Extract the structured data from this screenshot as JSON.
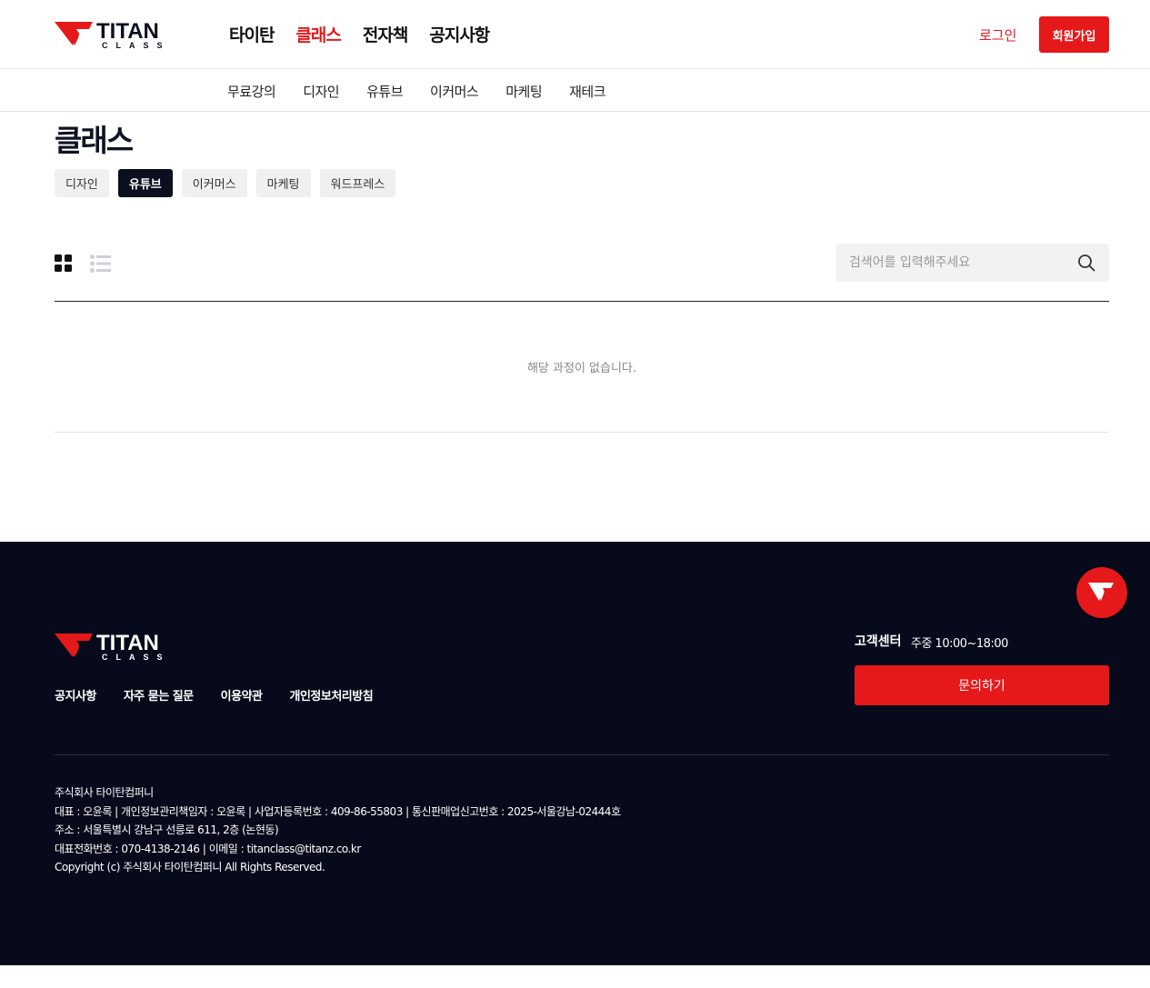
{
  "brand": {
    "logo_text": "TITAN",
    "logo_subtext": "CLASS",
    "accent_color": "#e6191a",
    "dark_color": "#060a1b"
  },
  "header": {
    "nav": [
      "타이탄",
      "클래스",
      "전자책",
      "공지사항"
    ],
    "active_nav": "클래스",
    "login_label": "로그인",
    "signup_label": "회원가입"
  },
  "sub_nav": [
    "무료강의",
    "디자인",
    "유튜브",
    "이커머스",
    "마케팅",
    "재테크"
  ],
  "page": {
    "title": "클래스",
    "chips": [
      "디자인",
      "유튜브",
      "이커머스",
      "마케팅",
      "워드프레스"
    ],
    "active_chip": "유튜브",
    "search_placeholder": "검색어를 입력해주세요",
    "empty_message": "해당 과정이 없습니다.",
    "view_mode": "grid"
  },
  "footer": {
    "links": [
      "공지사항",
      "자주 묻는 질문",
      "이용약관",
      "개인정보처리방침"
    ],
    "cs_title": "고객센터",
    "cs_hours": "주중 10:00~18:00",
    "inquiry_label": "문의하기",
    "info": [
      "주식회사 타이탄컴퍼니",
      "대표 : 오윤록 | 개인정보관리책임자 : 오윤록 | 사업자등록번호 : 409-86-55803 | 통신판매업신고번호 : 2025-서울강남-02444호",
      "주소 : 서울특별시 강남구 선릉로 611, 2층 (논현동)",
      "대표전화번호 : 070-4138-2146 | 이메일 : titanclass@titanz.co.kr",
      "Copyright (c) 주식회사 타이탄컴퍼니 All Rights Reserved."
    ]
  },
  "icons": {
    "logo": "titan-logo-icon",
    "grid_view": "grid-view-icon",
    "list_view": "list-view-icon",
    "search": "search-icon",
    "floating": "titan-chat-icon"
  }
}
